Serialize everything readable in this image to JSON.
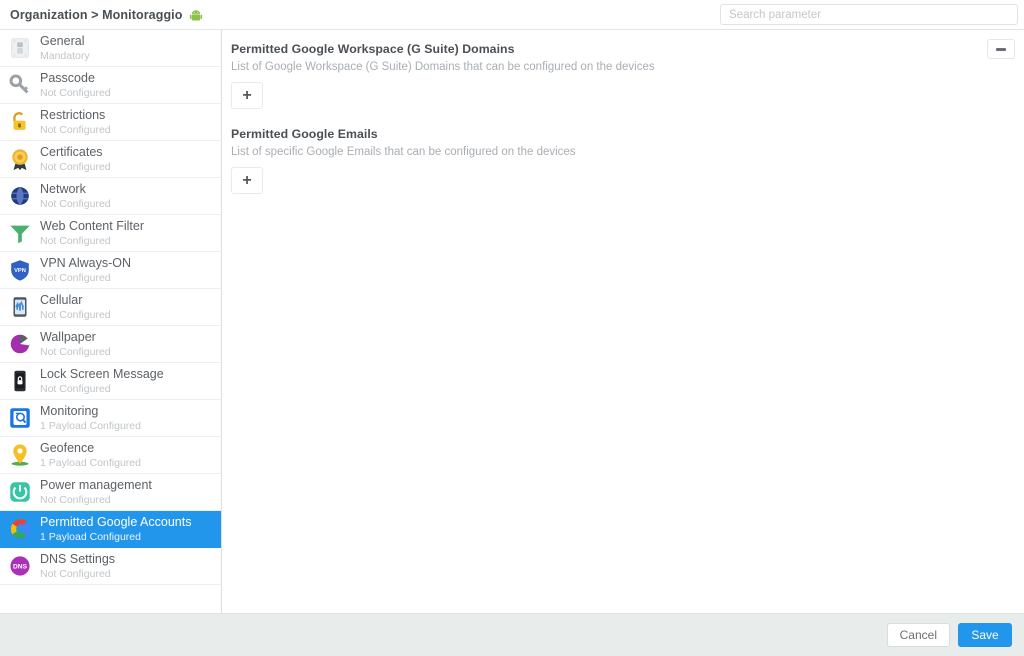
{
  "header": {
    "breadcrumb": "Organization > Monitoraggio",
    "platform_icon": "android-icon",
    "search": {
      "placeholder": "Search parameter",
      "value": ""
    }
  },
  "sidebar": {
    "items": [
      {
        "label": "General",
        "status": "Mandatory",
        "icon": "general-device-icon",
        "selected": false
      },
      {
        "label": "Passcode",
        "status": "Not Configured",
        "icon": "key-icon",
        "selected": false
      },
      {
        "label": "Restrictions",
        "status": "Not Configured",
        "icon": "padlock-icon",
        "selected": false
      },
      {
        "label": "Certificates",
        "status": "Not Configured",
        "icon": "certificate-rosette-icon",
        "selected": false
      },
      {
        "label": "Network",
        "status": "Not Configured",
        "icon": "globe-icon",
        "selected": false
      },
      {
        "label": "Web Content Filter",
        "status": "Not Configured",
        "icon": "funnel-icon",
        "selected": false
      },
      {
        "label": "VPN Always-ON",
        "status": "Not Configured",
        "icon": "vpn-shield-icon",
        "selected": false
      },
      {
        "label": "Cellular",
        "status": "Not Configured",
        "icon": "cellular-phone-icon",
        "selected": false
      },
      {
        "label": "Wallpaper",
        "status": "Not Configured",
        "icon": "wallpaper-icon",
        "selected": false
      },
      {
        "label": "Lock Screen Message",
        "status": "Not Configured",
        "icon": "lock-screen-icon",
        "selected": false
      },
      {
        "label": "Monitoring",
        "status": "1 Payload Configured",
        "icon": "monitoring-icon",
        "selected": false
      },
      {
        "label": "Geofence",
        "status": "1 Payload Configured",
        "icon": "map-pin-icon",
        "selected": false
      },
      {
        "label": "Power management",
        "status": "Not Configured",
        "icon": "power-icon",
        "selected": false
      },
      {
        "label": "Permitted Google Accounts",
        "status": "1 Payload Configured",
        "icon": "google-g-icon",
        "selected": true
      },
      {
        "label": "DNS Settings",
        "status": "Not Configured",
        "icon": "dns-icon",
        "selected": false
      }
    ]
  },
  "content": {
    "collapse_icon": "minimize-icon",
    "sections": [
      {
        "title": "Permitted Google Workspace (G Suite) Domains",
        "description": "List of Google Workspace (G Suite) Domains that can be configured on the devices",
        "add_label": "+"
      },
      {
        "title": "Permitted Google Emails",
        "description": "List of specific Google Emails that can be configured on the devices",
        "add_label": "+"
      }
    ]
  },
  "footer": {
    "cancel_label": "Cancel",
    "save_label": "Save"
  },
  "colors": {
    "accent": "#2196ea",
    "footer_bg": "#e8edec",
    "text": "#5c6166",
    "muted": "#c0c5c9"
  }
}
